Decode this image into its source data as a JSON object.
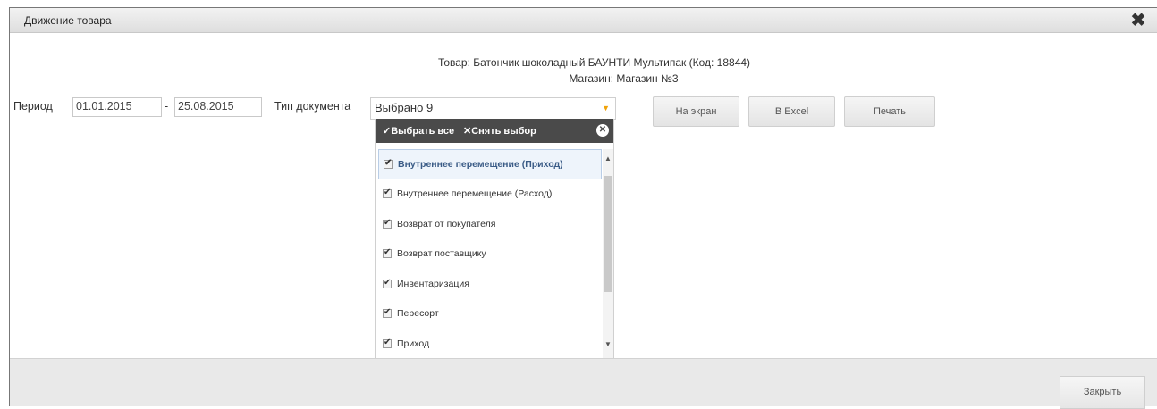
{
  "dialog": {
    "title": "Движение товара"
  },
  "info": {
    "product_line": "Товар: Батончик шоколадный БАУНТИ Мультипак (Код: 18844)",
    "store_line": "Магазин: Магазин №3"
  },
  "filters": {
    "period_label": "Период",
    "date_from": "01.01.2015",
    "date_separator": "-",
    "date_to": "25.08.2015",
    "doctype_label": "Тип документа",
    "doctype_value": "Выбрано 9"
  },
  "buttons": {
    "screen": "На экран",
    "excel": "В Excel",
    "print": "Печать",
    "close": "Закрыть"
  },
  "dropdown": {
    "select_all": "✓Выбрать все",
    "clear": "✕Снять выбор",
    "items": [
      "Внутреннее перемещение (Приход)",
      "Внутреннее перемещение (Расход)",
      "Возврат от покупателя",
      "Возврат поставщику",
      "Инвентаризация",
      "Пересорт",
      "Приход"
    ]
  },
  "icons": {
    "dialog_close": "close-icon",
    "dropdown_close": "circle-close-icon",
    "dropdown_arrow": "chevron-down-icon"
  }
}
